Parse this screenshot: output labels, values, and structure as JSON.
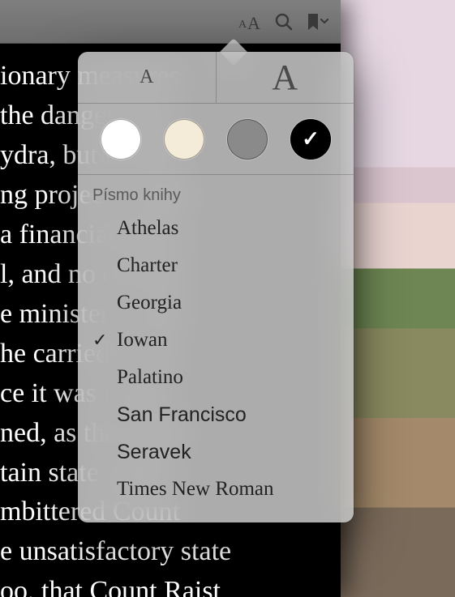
{
  "reader": {
    "text": "ionary measures\nthe danger from\nydra, but he had\nng project: to put\na financial basis,\nl, and no one but\ne ministers. And\nhe carried it out:\nce it was in just\nned, as the result\ntain state which\nmbittered Count\ne unsatisfactory state\noo, that Count Raist"
  },
  "popover": {
    "size_small_label": "A",
    "size_large_label": "A",
    "themes": [
      {
        "key": "white",
        "selected": false
      },
      {
        "key": "sepia",
        "selected": false
      },
      {
        "key": "gray",
        "selected": false
      },
      {
        "key": "black",
        "selected": true
      }
    ],
    "font_header": "Písmo knihy",
    "fonts": [
      {
        "name": "Athelas",
        "class": "f-athelas",
        "selected": false
      },
      {
        "name": "Charter",
        "class": "f-charter",
        "selected": false
      },
      {
        "name": "Georgia",
        "class": "f-georgia",
        "selected": false
      },
      {
        "name": "Iowan",
        "class": "f-iowan",
        "selected": true
      },
      {
        "name": "Palatino",
        "class": "f-palatino",
        "selected": false
      },
      {
        "name": "San Francisco",
        "class": "f-sanfran",
        "selected": false
      },
      {
        "name": "Seravek",
        "class": "f-seravek",
        "selected": false
      },
      {
        "name": "Times New Roman",
        "class": "f-times",
        "selected": false
      }
    ]
  }
}
